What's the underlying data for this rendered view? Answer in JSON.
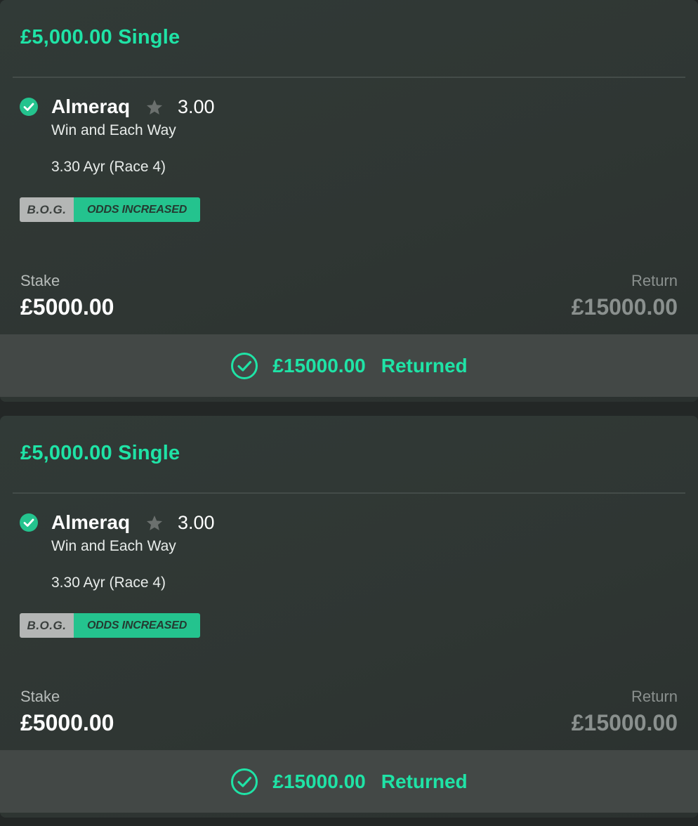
{
  "bets": [
    {
      "title": "£5,000.00 Single",
      "selection": {
        "name": "Almeraq",
        "odds": "3.00",
        "market": "Win and Each Way",
        "event": "3.30 Ayr (Race 4)",
        "status_icon": "check-circle-filled-icon",
        "favourite_icon": "star-icon"
      },
      "badges": {
        "bog": "B.O.G.",
        "odds_increased": "ODDS INCREASED"
      },
      "stake": {
        "label": "Stake",
        "value": "£5000.00"
      },
      "return": {
        "label": "Return",
        "value": "£15000.00"
      },
      "result": {
        "amount": "£15000.00",
        "text": "Returned",
        "icon": "check-circle-outline-icon"
      }
    },
    {
      "title": "£5,000.00 Single",
      "selection": {
        "name": "Almeraq",
        "odds": "3.00",
        "market": "Win and Each Way",
        "event": "3.30 Ayr (Race 4)",
        "status_icon": "check-circle-filled-icon",
        "favourite_icon": "star-icon"
      },
      "badges": {
        "bog": "B.O.G.",
        "odds_increased": "ODDS INCREASED"
      },
      "stake": {
        "label": "Stake",
        "value": "£5000.00"
      },
      "return": {
        "label": "Return",
        "value": "£15000.00"
      },
      "result": {
        "amount": "£15000.00",
        "text": "Returned",
        "icon": "check-circle-outline-icon"
      }
    }
  ],
  "colors": {
    "accent": "#1fe3a6",
    "badge_green": "#24c38e",
    "badge_grey": "#b4b6b5",
    "card_bg": "#2f3633",
    "result_bar_bg": "#434846",
    "muted_text": "#8a908e"
  }
}
